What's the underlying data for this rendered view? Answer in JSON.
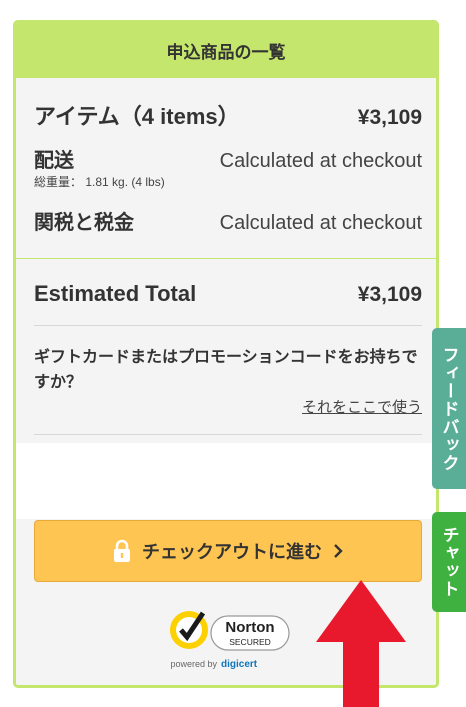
{
  "summary": {
    "title": "申込商品の一覧",
    "items_label": "アイテム（4 items）",
    "items_value": "¥3,109",
    "shipping_label": "配送",
    "shipping_value": "Calculated at checkout",
    "weight_text": "総重量： 1.81 kg. (4 lbs)",
    "duties_label": "関税と税金",
    "duties_value": "Calculated at checkout",
    "total_label": "Estimated Total",
    "total_value": "¥3,109",
    "promo_question": "ギフトカードまたはプロモーションコードをお持ちですか？",
    "promo_link": "それをここで使う",
    "checkout_button": "チェックアウトに進む",
    "badge": {
      "brand": "Norton",
      "secured": "SECURED",
      "powered_by": "powered by",
      "partner": "digicert"
    }
  },
  "side_tabs": {
    "feedback": "フィードバック",
    "chat": "チャット"
  },
  "colors": {
    "accent_green": "#c5e66d",
    "button_orange": "#ffc552",
    "feedback_tab": "#5aae97",
    "chat_tab": "#3fb141",
    "annotation_arrow": "#e8192c"
  }
}
